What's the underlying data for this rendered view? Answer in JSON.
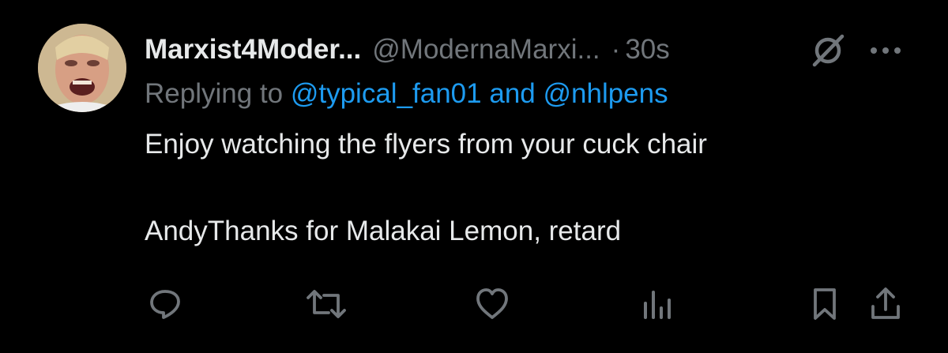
{
  "author": {
    "display_name": "Marxist4Moder...",
    "handle": "@ModernaMarxi...",
    "separator": "·",
    "timestamp": "30s"
  },
  "reply": {
    "prefix": "Replying to ",
    "mention1": "@typical_fan01",
    "joiner": " and ",
    "mention2": "@nhlpens"
  },
  "body": {
    "line1": "Enjoy watching the flyers from your cuck chair",
    "line2": "AndyThanks for Malakai Lemon, retard"
  },
  "icons": {
    "avatar": "avatar-image",
    "grok": "slashed-circle-icon",
    "more": "more-dots-icon",
    "actions": [
      "reply-icon",
      "repost-icon",
      "like-icon",
      "views-icon",
      "bookmark-icon",
      "share-icon"
    ]
  },
  "colors": {
    "background": "#000000",
    "text": "#e7e9ea",
    "secondary": "#71767b",
    "mention": "#1d9bf0"
  }
}
